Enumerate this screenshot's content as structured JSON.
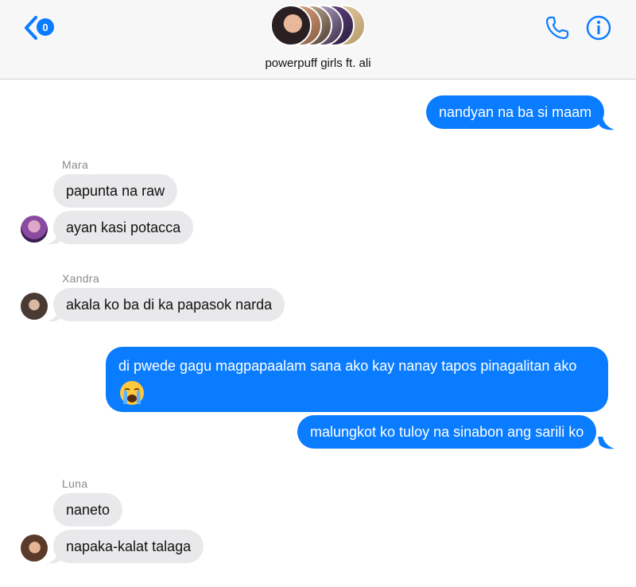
{
  "header": {
    "back_badge": "0",
    "group_name": "powerpuff girls ft. ali",
    "icons": {
      "back": "chevron-left-icon",
      "call": "phone-icon",
      "info": "info-icon"
    }
  },
  "colors": {
    "accent": "#0a7cff",
    "incoming_bubble": "#e9e9eb",
    "header_bg": "#f7f7f7"
  },
  "messages": [
    {
      "id": "m1",
      "direction": "outgoing",
      "text": "nandyan na ba si maam"
    },
    {
      "id": "m2",
      "direction": "incoming",
      "sender": "Mara",
      "text": "papunta na raw"
    },
    {
      "id": "m3",
      "direction": "incoming",
      "sender": "Mara",
      "text": "ayan kasi potacca"
    },
    {
      "id": "m4",
      "direction": "incoming",
      "sender": "Xandra",
      "text": "akala ko ba di ka papasok narda"
    },
    {
      "id": "m5",
      "direction": "outgoing",
      "text": "di pwede gagu magpapaalam sana ako kay nanay tapos pinagalitan ako",
      "emoji": "loudly-crying-face-emoji"
    },
    {
      "id": "m6",
      "direction": "outgoing",
      "text": "malungkot ko tuloy na sinabon ang sarili ko"
    },
    {
      "id": "m7",
      "direction": "incoming",
      "sender": "Luna",
      "text": "naneto"
    },
    {
      "id": "m8",
      "direction": "incoming",
      "sender": "Luna",
      "text": "napaka-kalat talaga"
    }
  ]
}
